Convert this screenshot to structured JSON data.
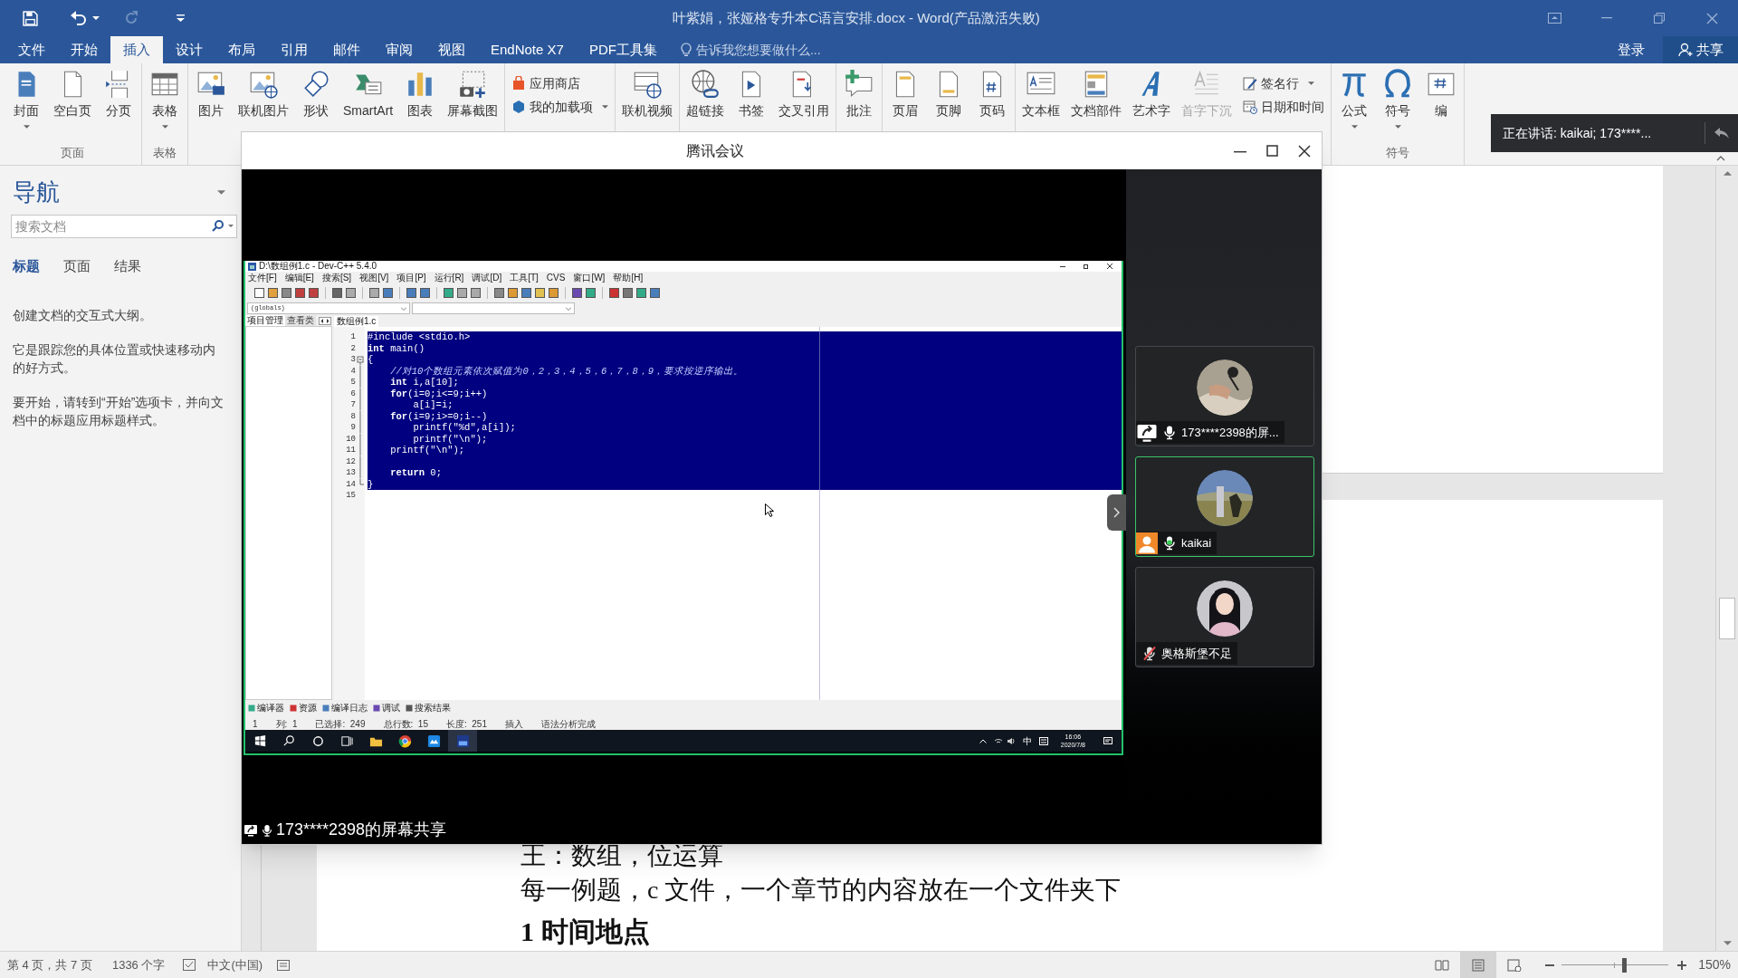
{
  "word": {
    "title": "叶紫娟，张娅格专升本C语言安排.docx - Word(产品激活失败)",
    "tabs": [
      {
        "label": "文件",
        "selected": false
      },
      {
        "label": "开始",
        "selected": false
      },
      {
        "label": "插入",
        "selected": true
      },
      {
        "label": "设计",
        "selected": false
      },
      {
        "label": "布局",
        "selected": false
      },
      {
        "label": "引用",
        "selected": false
      },
      {
        "label": "邮件",
        "selected": false
      },
      {
        "label": "审阅",
        "selected": false
      },
      {
        "label": "视图",
        "selected": false
      },
      {
        "label": "EndNote X7",
        "selected": false
      },
      {
        "label": "PDF工具集",
        "selected": false
      }
    ],
    "tell_me": "告诉我您想要做什么...",
    "sign_in": "登录",
    "share": "共享",
    "ribbon": [
      {
        "label": "页面",
        "items": [
          {
            "label": "封面",
            "kind": "large",
            "dropdown": true,
            "disabled": false
          },
          {
            "label": "空白页",
            "kind": "large",
            "dropdown": false,
            "disabled": false
          },
          {
            "label": "分页",
            "kind": "large",
            "dropdown": false,
            "disabled": false
          }
        ]
      },
      {
        "label": "表格",
        "items": [
          {
            "label": "表格",
            "kind": "large",
            "dropdown": true,
            "disabled": false
          }
        ]
      },
      {
        "items": [
          {
            "label": "图片",
            "kind": "large",
            "dropdown": false,
            "disabled": false
          },
          {
            "label": "联机图片",
            "kind": "large",
            "dropdown": false,
            "disabled": false
          },
          {
            "label": "形状",
            "kind": "large",
            "dropdown": false,
            "disabled": false
          },
          {
            "label": "SmartArt",
            "kind": "large",
            "dropdown": false,
            "disabled": false
          },
          {
            "label": "图表",
            "kind": "large",
            "dropdown": false,
            "disabled": false
          },
          {
            "label": "屏幕截图",
            "kind": "large",
            "dropdown": false,
            "disabled": false
          }
        ]
      },
      {
        "items": [
          {
            "label": "应用商店",
            "kind": "small",
            "dropdown": false,
            "disabled": false
          },
          {
            "label": "我的加载项",
            "kind": "small",
            "dropdown": true,
            "disabled": false
          }
        ]
      },
      {
        "items": [
          {
            "label": "联机视频",
            "kind": "large",
            "dropdown": false,
            "disabled": false
          }
        ]
      },
      {
        "items": [
          {
            "label": "超链接",
            "kind": "large",
            "dropdown": false,
            "disabled": false
          },
          {
            "label": "书签",
            "kind": "large",
            "dropdown": false,
            "disabled": false
          },
          {
            "label": "交叉引用",
            "kind": "large",
            "dropdown": false,
            "disabled": false
          }
        ]
      },
      {
        "items": [
          {
            "label": "批注",
            "kind": "large",
            "dropdown": false,
            "disabled": false
          }
        ]
      },
      {
        "items": [
          {
            "label": "页眉",
            "kind": "large",
            "dropdown": false,
            "disabled": false
          },
          {
            "label": "页脚",
            "kind": "large",
            "dropdown": false,
            "disabled": false
          },
          {
            "label": "页码",
            "kind": "large",
            "dropdown": false,
            "disabled": false
          }
        ]
      },
      {
        "items": [
          {
            "label": "文本框",
            "kind": "large",
            "dropdown": false,
            "disabled": false
          },
          {
            "label": "文档部件",
            "kind": "large",
            "dropdown": false,
            "disabled": false
          },
          {
            "label": "艺术字",
            "kind": "large",
            "dropdown": false,
            "disabled": false
          },
          {
            "label": "首字下沉",
            "kind": "large",
            "dropdown": false,
            "disabled": true
          },
          {
            "label": "签名行",
            "kind": "small",
            "dropdown": true,
            "disabled": false
          },
          {
            "label": "日期和时间",
            "kind": "small",
            "dropdown": false,
            "disabled": false
          }
        ]
      },
      {
        "label": "符号",
        "items": [
          {
            "label": "公式",
            "kind": "large",
            "dropdown": true,
            "disabled": false
          },
          {
            "label": "符号",
            "kind": "large",
            "dropdown": true,
            "disabled": false
          },
          {
            "label": "编",
            "kind": "large",
            "dropdown": false,
            "disabled": false
          }
        ]
      }
    ],
    "navigation": {
      "title": "导航",
      "search_placeholder": "搜索文档",
      "tabs": [
        {
          "label": "标题",
          "selected": true
        },
        {
          "label": "页面",
          "selected": false
        },
        {
          "label": "结果",
          "selected": false
        }
      ],
      "paragraphs": [
        [
          "创建文档的交互式大纲。"
        ],
        [
          "它是跟踪您的具体位置或快速移动内",
          "的好方式。"
        ],
        [
          "要开始，请转到“开始”选项卡，并向文",
          "档中的标题应用标题样式。"
        ]
      ]
    },
    "document": [
      {
        "kind": "body",
        "text": "王：数组，位运算"
      },
      {
        "kind": "body",
        "text": "每一例题，c 文件，一个章节的内容放在一个文件夹下"
      },
      {
        "kind": "heading",
        "text": "1 时间地点"
      }
    ],
    "status_bar": {
      "page": "第 4 页，共 7 页",
      "words": "1336 个字",
      "language": "中文(中国)",
      "views": [
        {
          "selected": false
        },
        {
          "selected": true
        },
        {
          "selected": false
        }
      ],
      "zoom": {
        "level": 0.58,
        "reading": "150%"
      }
    }
  },
  "meeting": {
    "title": "腾讯会议",
    "share_label": "173****2398的屏幕共享",
    "participants": [
      {
        "name": "173****2398的屏...",
        "sharing": true,
        "host": false,
        "speaking": false,
        "muted": false,
        "selected": false
      },
      {
        "name": "kaikai",
        "sharing": false,
        "host": true,
        "speaking": true,
        "muted": false,
        "selected": true
      },
      {
        "name": "奥格斯堡不足",
        "sharing": false,
        "host": false,
        "speaking": false,
        "muted": true,
        "selected": false
      }
    ],
    "speaking_toast": "正在讲话: kaikai; 173****..."
  },
  "shared_screen": {
    "title": "D:\\数组例1.c - Dev-C++ 5.4.0",
    "menu": [
      "文件[F]",
      "编辑[E]",
      "搜索[S]",
      "视图[V]",
      "项目[P]",
      "运行[R]",
      "调试[D]",
      "工具[T]",
      "CVS",
      "窗口[W]",
      "帮助[H]"
    ],
    "scope": "(globals)",
    "side_tabs": [
      {
        "label": "项目管理",
        "selected": true
      },
      {
        "label": "查看类",
        "selected": false
      }
    ],
    "file_tab": "数组例1.c",
    "code": [
      {
        "number": "1",
        "kind": "code",
        "text": "#include <stdio.h>",
        "selected": true
      },
      {
        "number": "2",
        "kind": "code",
        "text": "**int** main()",
        "selected": true
      },
      {
        "number": "3",
        "kind": "code",
        "text": "{",
        "selected": true,
        "expanded": true
      },
      {
        "number": "4",
        "kind": "comment",
        "text": "    //对10个数组元素依次赋值为0，2，3，4，5，6，7，8，9，要求按逆序输出。",
        "selected": true,
        "in_fold": true
      },
      {
        "number": "5",
        "kind": "code",
        "text": "    **int** i,a[10];",
        "selected": true,
        "in_fold": true
      },
      {
        "number": "6",
        "kind": "code",
        "text": "    **for**(i=0;i<=9;i++)",
        "selected": true,
        "in_fold": true
      },
      {
        "number": "7",
        "kind": "code",
        "text": "        a[i]=i;",
        "selected": true,
        "in_fold": true
      },
      {
        "number": "8",
        "kind": "code",
        "text": "    **for**(i=9;i>=0;i--)",
        "selected": true,
        "in_fold": true
      },
      {
        "number": "9",
        "kind": "code",
        "text": "        printf(\"%d\",a[i]);",
        "selected": true,
        "in_fold": true
      },
      {
        "number": "10",
        "kind": "code",
        "text": "        printf(\"\\n\");",
        "selected": true,
        "in_fold": true
      },
      {
        "number": "11",
        "kind": "code",
        "text": "    printf(\"\\n\");",
        "selected": true,
        "in_fold": true
      },
      {
        "number": "12",
        "kind": "code",
        "selected": true,
        "in_fold": true
      },
      {
        "number": "13",
        "kind": "code",
        "text": "    **return** 0;",
        "selected": true,
        "in_fold": true
      },
      {
        "number": "14",
        "kind": "code",
        "text": "}",
        "selected": true,
        "in_fold": true,
        "fold_end": true
      },
      {
        "number": "15",
        "kind": "code",
        "selected": false
      }
    ],
    "bottom_tabs": [
      "编译器",
      "资源",
      "编译日志",
      "调试",
      "搜索结果"
    ],
    "status": [
      "1",
      "列:  1",
      "已选择:  249",
      "总行数:  15",
      "长度:  251",
      "插入",
      "语法分析完成"
    ],
    "taskbar": {
      "ime": "中",
      "time": "16:06",
      "date": "2020/7/8"
    }
  }
}
